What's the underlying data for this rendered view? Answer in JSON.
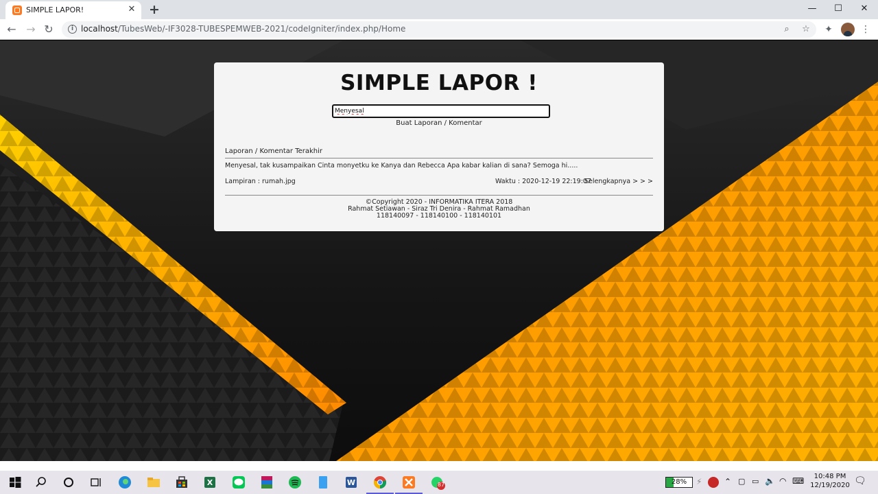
{
  "browser": {
    "tab_title": "SIMPLE LAPOR!",
    "url_host": "localhost",
    "url_path": "/TubesWeb/-IF3028-TUBESPEMWEB-2021/codeIgniter/index.php/Home"
  },
  "card": {
    "title": "SIMPLE LAPOR !",
    "search_value": "Menyesal",
    "create_link": "Buat Laporan / Komentar",
    "section_label": "Laporan / Komentar Terakhir",
    "report": {
      "text": "Menyesal, tak kusampaikan Cinta monyetku ke Kanya dan Rebecca Apa kabar kalian di sana? Semoga hi.....",
      "attachment": "Lampiran : rumah.jpg",
      "time": "Waktu : 2020-12-19 22:19:07",
      "more": "Selengkapnya > > >"
    },
    "footer": {
      "line1": "©Copyright 2020 - INFORMATIKA ITERA 2018",
      "line2": "Rahmat Setiawan - Siraz Tri Denira - Rahmat Ramadhan",
      "line3": "118140097 - 118140100 - 118140101"
    }
  },
  "taskbar": {
    "battery": "28%",
    "time": "10:48 PM",
    "date": "12/19/2020",
    "whatsapp_badge": "87"
  },
  "colors": {
    "accent_yellow": "#ffb000",
    "accent_orange": "#f07a00",
    "bg_dark": "#151515"
  }
}
